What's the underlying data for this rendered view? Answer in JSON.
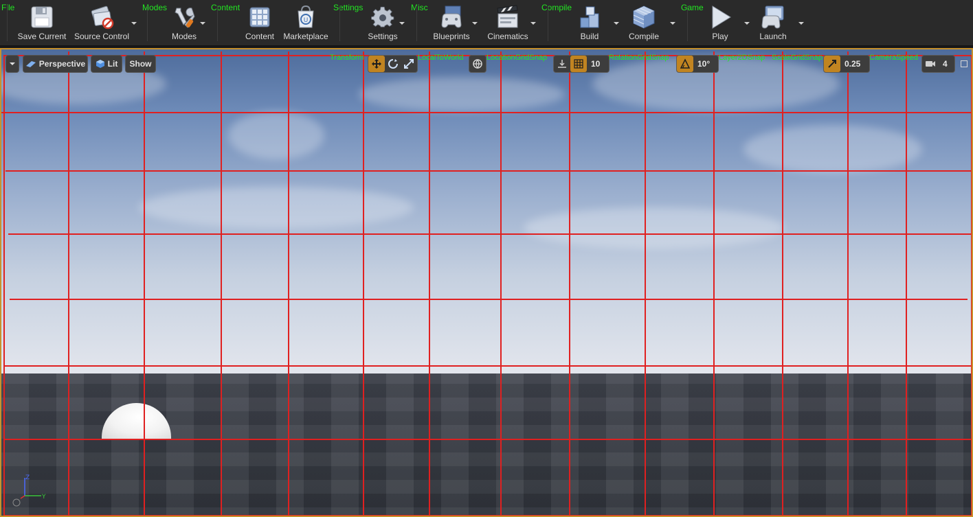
{
  "toolbar": {
    "sections": {
      "file": "File",
      "modes": "Modes",
      "content": "Content",
      "settings": "Settings",
      "misc": "Misc",
      "compile": "Compile",
      "game": "Game"
    },
    "buttons": {
      "save_current": "Save Current",
      "source_control": "Source Control",
      "modes": "Modes",
      "content": "Content",
      "marketplace": "Marketplace",
      "settings": "Settings",
      "blueprints": "Blueprints",
      "cinematics": "Cinematics",
      "build": "Build",
      "compile": "Compile",
      "play": "Play",
      "launch": "Launch"
    }
  },
  "viewport": {
    "view_mode": "Perspective",
    "lighting": "Lit",
    "show": "Show",
    "group_labels": {
      "transform": "Transform",
      "local_to_world": "LocalToWorld",
      "location_grid_snap": "LocationGridSnap",
      "rotation_grid_snap": "RotationGridSnap",
      "layer2d_snap": "Layer2DSnap",
      "scale_grid_snap": "ScaleGridSnap",
      "camera_speed": "CameraSpeed"
    },
    "location_snap_value": "10",
    "rotation_snap_value": "10°",
    "scale_snap_value": "0.25",
    "camera_speed_value": "4",
    "axis_labels": {
      "z": "Z",
      "y": "Y"
    }
  },
  "colors": {
    "section_label": "#22e622",
    "accent": "#c18421",
    "grid_overlay": "#e02020"
  }
}
